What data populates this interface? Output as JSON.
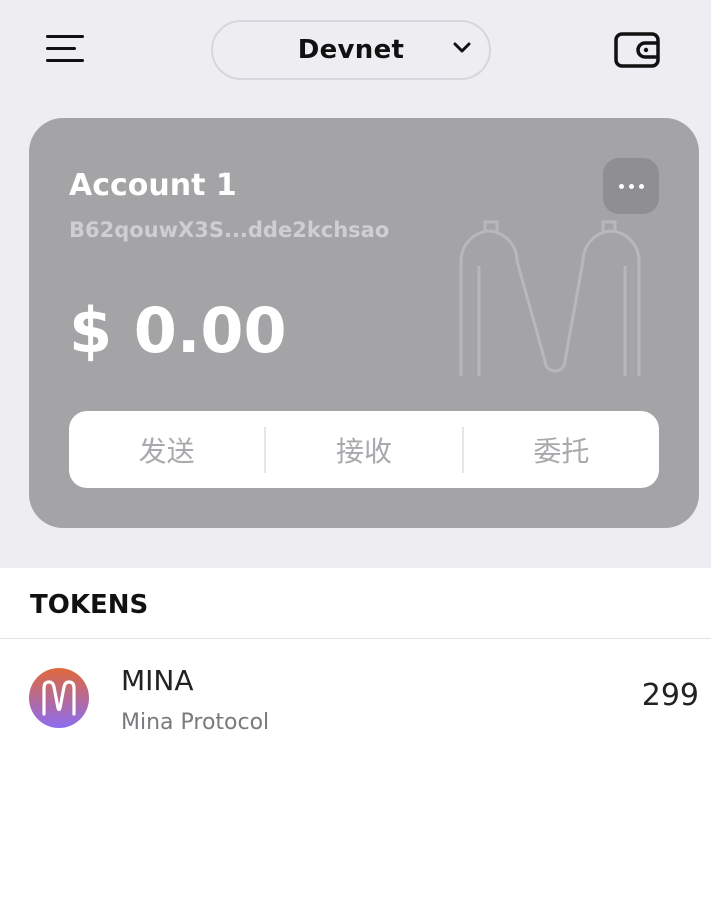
{
  "header": {
    "network": "Devnet",
    "icons": {
      "menu": "menu-icon",
      "chevron": "chevron-down-icon",
      "wallet": "wallet-icon"
    }
  },
  "account": {
    "name": "Account 1",
    "address": "B62qouwX3S...dde2kchsao",
    "balance": "$ 0.00",
    "more_icon": "more-dots-icon"
  },
  "actions": {
    "send": "发送",
    "receive": "接收",
    "delegate": "委托"
  },
  "tokens": {
    "title": "TOKENS",
    "items": [
      {
        "symbol": "MINA",
        "name": "Mina Protocol",
        "amount": "299",
        "icon": "mina-logo-icon"
      }
    ]
  },
  "colors": {
    "background": "#eeeef2",
    "card": "#a4a4a6",
    "mina_gradient_top": "#e0683a",
    "mina_gradient_bottom": "#8c6cf2"
  }
}
